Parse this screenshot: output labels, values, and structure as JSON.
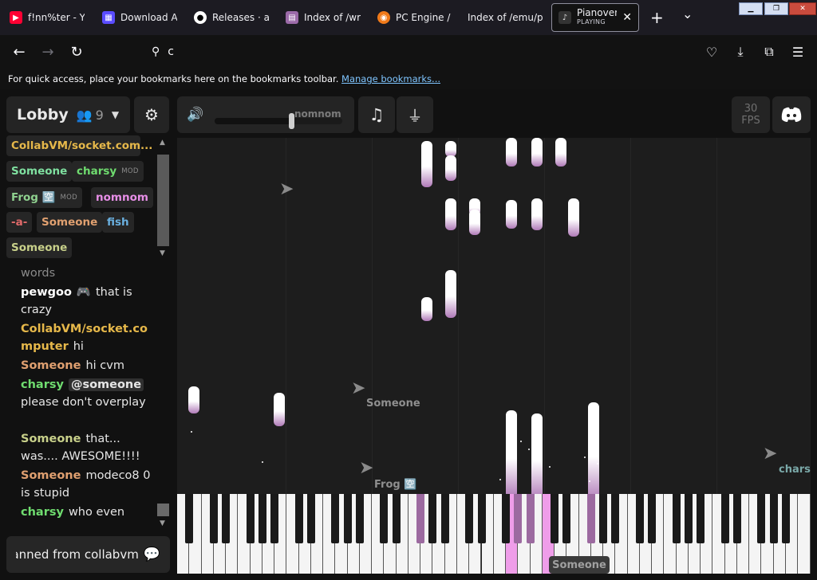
{
  "browser": {
    "tabs": [
      {
        "title": "f!nn%ter - Yo",
        "icon": "youtube-icon",
        "color": "#ff0033"
      },
      {
        "title": "Download Ar",
        "icon": "archive-icon",
        "color": "#7a5cff"
      },
      {
        "title": "Releases · are",
        "icon": "github-icon",
        "color": "#ffffff"
      },
      {
        "title": "Index of /wra",
        "icon": "archive-icon",
        "color": "#9b6aa8"
      },
      {
        "title": "PC Engine / T",
        "icon": "globe-icon",
        "color": "#f07a1a"
      },
      {
        "title": "Index of /emu/pc",
        "icon": "blank-icon",
        "color": "#1c1b22"
      }
    ],
    "active_tab": {
      "title": "Pianoverse",
      "subtitle": "PLAYING"
    },
    "address": "c",
    "bookmarks_hint": "For quick access, place your bookmarks here on the bookmarks toolbar.",
    "bookmarks_link": "Manage bookmarks..."
  },
  "toolbar": {
    "room": "Lobby",
    "user_count": "9",
    "volume": 0.6,
    "volume_label": "nomnom",
    "fps_value": "30",
    "fps_unit": "FPS"
  },
  "users": [
    {
      "name": "CollabVM/socket.com...",
      "color": "#e6b84a",
      "mod": ""
    },
    {
      "name": "Someone",
      "color": "#7fe0a0",
      "mod": ""
    },
    {
      "name": "charsy",
      "color": "#6fdc6f",
      "mod": "MOD"
    },
    {
      "name": "Frog 🈳",
      "color": "#8fd18f",
      "mod": "MOD"
    },
    {
      "name": "nomnom",
      "color": "#e88fe8",
      "mod": ""
    },
    {
      "name": "-a-",
      "color": "#e06a6a",
      "mod": ""
    },
    {
      "name": "Someone",
      "color": "#e0a070",
      "mod": ""
    },
    {
      "name": "fish",
      "color": "#6ab0e0",
      "mod": ""
    },
    {
      "name": "Someone",
      "color": "#c8d08a",
      "mod": ""
    }
  ],
  "chat": [
    {
      "name": "",
      "color": "#9a9a9a",
      "text": "words"
    },
    {
      "name": "pewgoo",
      "color": "#ffffff",
      "text": "that is crazy"
    },
    {
      "name": "CollabVM/socket.computer",
      "color": "#e6b84a",
      "text": "hi"
    },
    {
      "name": "Someone",
      "color": "#e0a070",
      "text": "hi cvm"
    },
    {
      "name": "charsy",
      "color": "#6fdc6f",
      "text": "please don't overplay",
      "mention": "@someone"
    },
    {
      "name": "Someone",
      "color": "#c8d08a",
      "text": "that... was.... AWESOME!!!!"
    },
    {
      "name": "Someone",
      "color": "#e0a070",
      "text": "modeco8 0 is stupid"
    },
    {
      "name": "charsy",
      "color": "#6fdc6f",
      "text": "who even"
    }
  ],
  "chat_input": {
    "value": "banned from collabvm"
  },
  "cursors": [
    {
      "name": "nomnom",
      "color": "#8a8a8a"
    },
    {
      "name": "Someone",
      "color": "#8a8a8a"
    },
    {
      "name": "Frog 🈳",
      "color": "#8a8a8a"
    },
    {
      "name": "charsy",
      "color": "#7aa8a8"
    },
    {
      "name": "Someone",
      "color": "#a0a0a0"
    }
  ],
  "colors": {
    "accent_pink": "#ef9de9",
    "accent_purple": "#9c6aa0",
    "panel": "#242424"
  }
}
